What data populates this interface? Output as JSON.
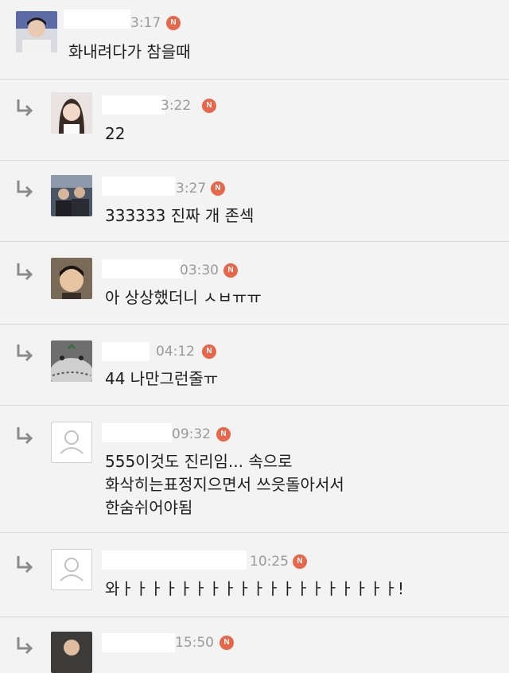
{
  "badge_label": "N",
  "comments": [
    {
      "time": "3:17",
      "text": "화내려다가 참을때"
    },
    {
      "time": "3:22",
      "text": "22"
    },
    {
      "time": "3:27",
      "text": "333333 진짜 개 존섹"
    },
    {
      "time": "03:30",
      "text": "아 상상했더니 ㅅㅂㅠㅠ"
    },
    {
      "time": "04:12",
      "text": "44 나만그런줄ㅠ"
    },
    {
      "time": "09:32",
      "text": "555이것도 진리임... 속으로\n화삭히는표정지으면서 쓰읏돌아서서\n한숨쉬어야됨"
    },
    {
      "time": "10:25",
      "text": "와ㅏㅏㅏㅏㅏㅏㅏㅏㅏㅏㅏㅏㅏㅏㅏㅏㅏㅏㅏ!"
    },
    {
      "time": "15:50",
      "text": ""
    }
  ],
  "colors": {
    "badge": "#e8674a",
    "background": "#f3f3f3",
    "divider": "#d8d8d8",
    "time": "#9a9a9a"
  }
}
